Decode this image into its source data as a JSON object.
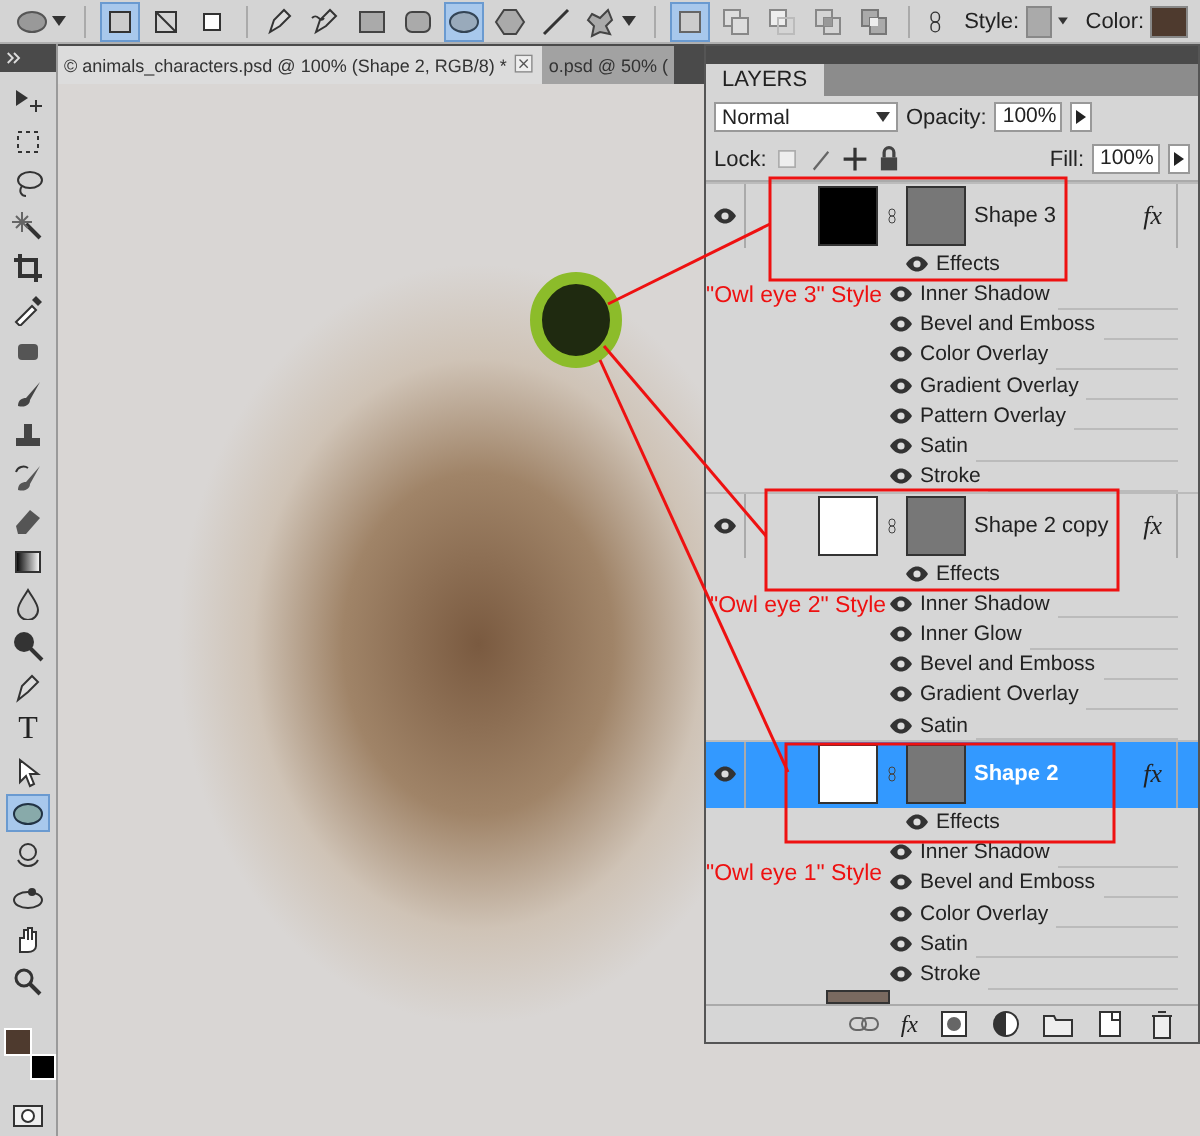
{
  "options_bar": {
    "tools": [
      {
        "kind": "ellipse-preset",
        "selected": false
      },
      {
        "kind": "shape-layers",
        "selected": true
      },
      {
        "kind": "paths",
        "selected": false
      },
      {
        "kind": "fill-pixels",
        "selected": false
      },
      {
        "kind": "pen",
        "selected": false
      },
      {
        "kind": "freeform-pen",
        "selected": false
      },
      {
        "kind": "rectangle",
        "selected": false
      },
      {
        "kind": "rounded-rectangle",
        "selected": false
      },
      {
        "kind": "ellipse",
        "selected": true
      },
      {
        "kind": "polygon",
        "selected": false
      },
      {
        "kind": "line",
        "selected": false
      },
      {
        "kind": "custom-shape",
        "selected": false
      },
      {
        "kind": "mode-new",
        "selected": true
      },
      {
        "kind": "mode-add",
        "selected": false
      },
      {
        "kind": "mode-subtract",
        "selected": false
      },
      {
        "kind": "mode-intersect",
        "selected": false
      },
      {
        "kind": "mode-exclude",
        "selected": false
      }
    ],
    "style_label": "Style:",
    "color_label": "Color:",
    "color": "#4e3a2e"
  },
  "document_tabs": [
    {
      "label": "© animals_characters.psd @ 100% (Shape 2, RGB/8) *",
      "selected": true
    },
    {
      "label": "o.psd @ 50% (",
      "selected": false
    }
  ],
  "toolbox": {
    "tools": [
      {
        "kind": "move",
        "selected": false
      },
      {
        "kind": "marquee",
        "selected": false
      },
      {
        "kind": "lasso",
        "selected": false
      },
      {
        "kind": "wand",
        "selected": false
      },
      {
        "kind": "crop",
        "selected": false
      },
      {
        "kind": "eyedropper",
        "selected": false
      },
      {
        "kind": "healing",
        "selected": false
      },
      {
        "kind": "brush",
        "selected": false
      },
      {
        "kind": "stamp",
        "selected": false
      },
      {
        "kind": "history-brush",
        "selected": false
      },
      {
        "kind": "eraser",
        "selected": false
      },
      {
        "kind": "gradient",
        "selected": false
      },
      {
        "kind": "blur",
        "selected": false
      },
      {
        "kind": "dodge",
        "selected": false
      },
      {
        "kind": "pen",
        "selected": false
      },
      {
        "kind": "type",
        "label": "T",
        "selected": false
      },
      {
        "kind": "path-select",
        "selected": false
      },
      {
        "kind": "ellipse",
        "selected": true
      },
      {
        "kind": "rotate-3d",
        "selected": false
      },
      {
        "kind": "orbit-3d",
        "selected": false
      },
      {
        "kind": "hand",
        "selected": false
      },
      {
        "kind": "zoom",
        "selected": false
      }
    ],
    "swatches": [
      {
        "kind": "foreground",
        "color": "#4e3a2e"
      },
      {
        "kind": "background",
        "color": "#000000"
      }
    ]
  },
  "layers_panel": {
    "title": "LAYERS",
    "blend_mode": "Normal",
    "opacity_label": "Opacity:",
    "opacity": "100%",
    "lock_label": "Lock:",
    "fill_label": "Fill:",
    "fill": "100%",
    "layers": [
      {
        "name": "Shape 3",
        "selected": false,
        "visible": true,
        "color": "#000000",
        "fx": "fx",
        "effects_label": "Effects",
        "effects": [
          "Inner Shadow",
          "Bevel and Emboss",
          "Color Overlay",
          "Gradient Overlay",
          "Pattern Overlay",
          "Satin",
          "Stroke"
        ]
      },
      {
        "name": "Shape 2 copy",
        "selected": false,
        "visible": true,
        "color": "#ffffff",
        "fx": "fx",
        "effects_label": "Effects",
        "effects": [
          "Inner Shadow",
          "Inner Glow",
          "Bevel and Emboss",
          "Gradient Overlay",
          "Satin"
        ]
      },
      {
        "name": "Shape 2",
        "selected": true,
        "visible": true,
        "color": "#ffffff",
        "fx": "fx",
        "effects_label": "Effects",
        "effects": [
          "Inner Shadow",
          "Bevel and Emboss",
          "Color Overlay",
          "Satin",
          "Stroke"
        ]
      }
    ],
    "footer_fx": "fx"
  },
  "annotations": [
    {
      "text": "\"Owl eye 3\" Style"
    },
    {
      "text": "\"Owl eye 2\" Style"
    },
    {
      "text": "\"Owl eye 1\" Style"
    }
  ]
}
